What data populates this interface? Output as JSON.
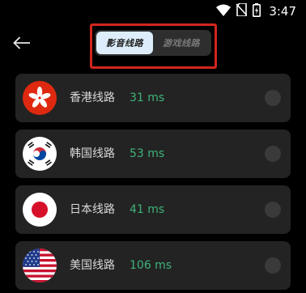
{
  "status_bar": {
    "time": "3:47",
    "icons": [
      "wifi-icon",
      "no-sim-icon",
      "battery-charging-icon"
    ]
  },
  "header": {
    "back_icon": "back-arrow-icon",
    "tabs": [
      {
        "label": "影音线路",
        "active": true
      },
      {
        "label": "游戏线路",
        "active": false
      }
    ],
    "highlight_color": "#d1261e"
  },
  "routes": [
    {
      "name": "香港线路",
      "latency": "31 ms",
      "flag": "hong-kong-flag-icon",
      "selected": false
    },
    {
      "name": "韩国线路",
      "latency": "53 ms",
      "flag": "south-korea-flag-icon",
      "selected": false
    },
    {
      "name": "日本线路",
      "latency": "41 ms",
      "flag": "japan-flag-icon",
      "selected": false
    },
    {
      "name": "美国线路",
      "latency": "106 ms",
      "flag": "usa-flag-icon",
      "selected": false
    }
  ],
  "colors": {
    "background": "#000000",
    "card": "#232323",
    "latency": "#3fb37a",
    "tab_active": "#ddeefa"
  }
}
